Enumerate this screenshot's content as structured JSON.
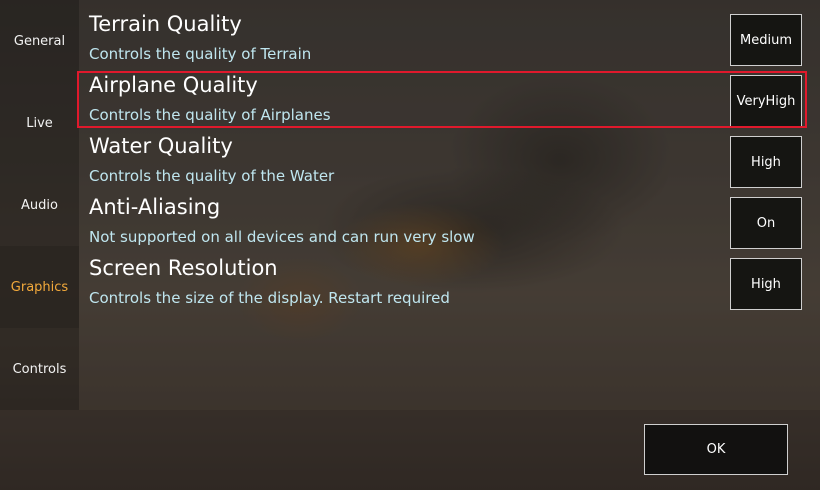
{
  "sidebar": {
    "items": [
      {
        "label": "General"
      },
      {
        "label": "Live"
      },
      {
        "label": "Audio"
      },
      {
        "label": "Graphics",
        "active": true
      },
      {
        "label": "Controls"
      }
    ]
  },
  "settings": [
    {
      "title": "Terrain Quality",
      "description": "Controls the quality of Terrain",
      "value": "Medium"
    },
    {
      "title": "Airplane Quality",
      "description": "Controls the quality of Airplanes",
      "value": "VeryHigh",
      "highlighted": true
    },
    {
      "title": "Water Quality",
      "description": "Controls the quality of the Water",
      "value": "High"
    },
    {
      "title": "Anti-Aliasing",
      "description": "Not supported on all devices and can run very slow",
      "value": "On"
    },
    {
      "title": "Screen Resolution",
      "description": "Controls the size of the display. Restart required",
      "value": "High"
    }
  ],
  "footer": {
    "ok_label": "OK"
  },
  "colors": {
    "active_tab": "#f2a93b",
    "description_text": "#bfe6ef",
    "highlight_border": "#e0192c"
  }
}
